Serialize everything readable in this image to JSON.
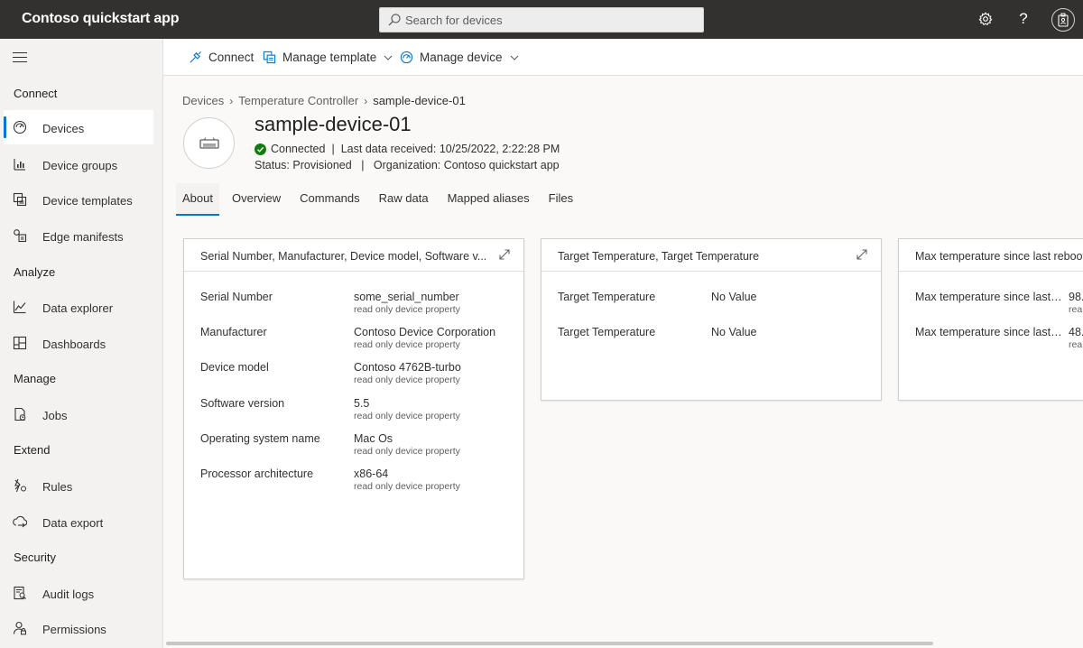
{
  "app": {
    "title": "Contoso quickstart app"
  },
  "search": {
    "placeholder": "Search for devices"
  },
  "topbar": {
    "help_label": "?"
  },
  "sidebar": {
    "sections": [
      {
        "label": "Connect",
        "items": [
          {
            "label": "Devices",
            "icon": "devices-icon",
            "active": true
          },
          {
            "label": "Device groups",
            "icon": "device-groups-icon"
          },
          {
            "label": "Device templates",
            "icon": "device-templates-icon"
          },
          {
            "label": "Edge manifests",
            "icon": "edge-manifests-icon"
          }
        ]
      },
      {
        "label": "Analyze",
        "items": [
          {
            "label": "Data explorer",
            "icon": "data-explorer-icon"
          },
          {
            "label": "Dashboards",
            "icon": "dashboards-icon"
          }
        ]
      },
      {
        "label": "Manage",
        "items": [
          {
            "label": "Jobs",
            "icon": "jobs-icon"
          }
        ]
      },
      {
        "label": "Extend",
        "items": [
          {
            "label": "Rules",
            "icon": "rules-icon"
          },
          {
            "label": "Data export",
            "icon": "data-export-icon"
          }
        ]
      },
      {
        "label": "Security",
        "items": [
          {
            "label": "Audit logs",
            "icon": "audit-logs-icon"
          },
          {
            "label": "Permissions",
            "icon": "permissions-icon"
          }
        ]
      }
    ]
  },
  "commands": {
    "connect": "Connect",
    "manage_template": "Manage template",
    "manage_device": "Manage device"
  },
  "breadcrumb": {
    "items": [
      "Devices",
      "Temperature Controller",
      "sample-device-01"
    ]
  },
  "device": {
    "name": "sample-device-01",
    "connection": "Connected",
    "last_data": "Last data received: 10/25/2022, 2:22:28 PM",
    "status": "Status: Provisioned",
    "organization": "Organization: Contoso quickstart app",
    "status_color": "#107c10"
  },
  "tabs": [
    "About",
    "Overview",
    "Commands",
    "Raw data",
    "Mapped aliases",
    "Files"
  ],
  "cards": [
    {
      "title": "Serial Number, Manufacturer, Device model, Software v...",
      "properties": [
        {
          "label": "Serial Number",
          "value": "some_serial_number",
          "sub": "read only device property"
        },
        {
          "label": "Manufacturer",
          "value": "Contoso Device Corporation",
          "sub": "read only device property"
        },
        {
          "label": "Device model",
          "value": "Contoso 4762B-turbo",
          "sub": "read only device property"
        },
        {
          "label": "Software version",
          "value": "5.5",
          "sub": "read only device property"
        },
        {
          "label": "Operating system name",
          "value": "Mac Os",
          "sub": "read only device property"
        },
        {
          "label": "Processor architecture",
          "value": "x86-64",
          "sub": "read only device property"
        }
      ]
    },
    {
      "title": "Target Temperature, Target Temperature",
      "properties": [
        {
          "label": "Target Temperature",
          "value": "No Value"
        },
        {
          "label": "Target Temperature",
          "value": "No Value"
        }
      ]
    },
    {
      "title": "Max temperature since last reboot",
      "properties": [
        {
          "label": "Max temperature since last r...",
          "value": "98.",
          "sub": "rea"
        },
        {
          "label": "Max temperature since last r...",
          "value": "48.",
          "sub": "rea"
        }
      ]
    }
  ],
  "colors": {
    "accent": "#0078d4",
    "topbar": "#323130"
  }
}
